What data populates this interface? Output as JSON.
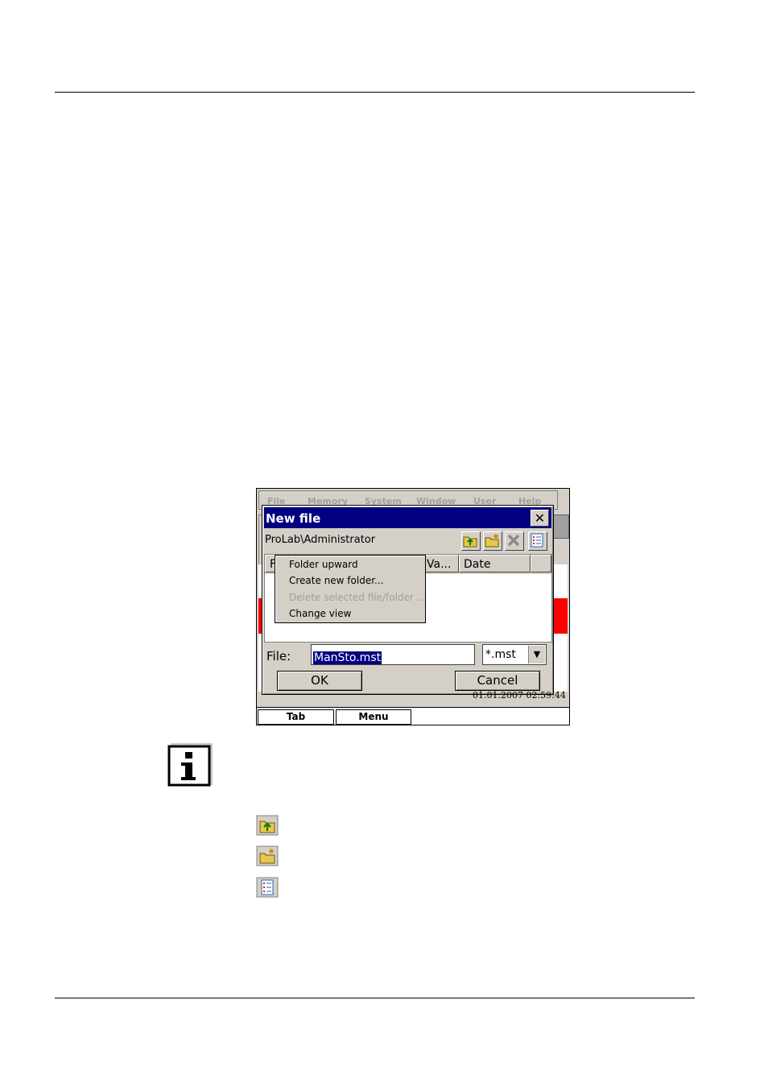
{
  "dialog": {
    "title": "New file",
    "path": "ProLab\\Administrator",
    "columns": [
      "F",
      "Va...",
      "Date"
    ],
    "context_menu": [
      "Folder upward",
      "Create new folder...",
      "Delete selected file/folder ...",
      "Change view"
    ],
    "file_label": "File:",
    "file_value": "ManSto.mst",
    "filter_value": "*.mst",
    "ok_label": "OK",
    "cancel_label": "Cancel"
  },
  "background_app": {
    "menu": [
      "File",
      "Memory",
      "System",
      "Window",
      "User",
      "Help"
    ],
    "timestamp": "01.01.2007 02:59:44",
    "taskbar": [
      "Tab",
      "Menu"
    ]
  },
  "icons": {
    "toolbar": [
      "folder-up-icon",
      "new-folder-icon",
      "delete-icon",
      "change-view-icon"
    ],
    "info": "info-icon"
  },
  "colors": {
    "titlebar": "#000080",
    "dialog_face": "#d4d0c8",
    "selection": "#000080",
    "alert": "#ff0000"
  }
}
